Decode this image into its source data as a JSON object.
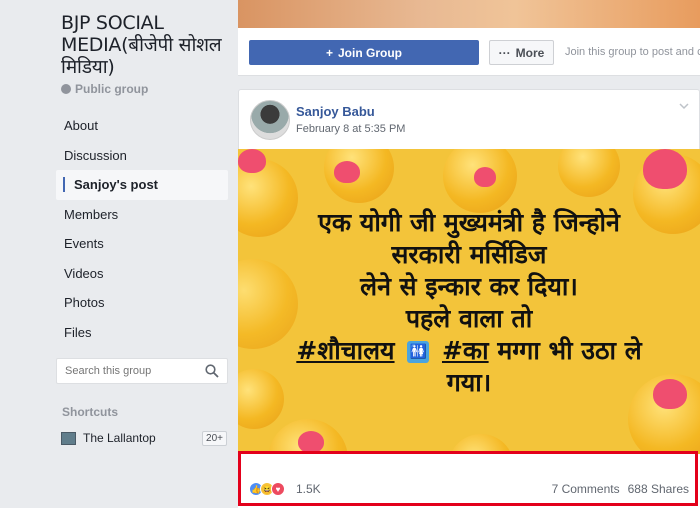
{
  "sidebar": {
    "group_title": "BJP SOCIAL MEDIA(बीजेपी सोशल मिडिया)",
    "privacy": "Public group",
    "nav": [
      {
        "label": "About"
      },
      {
        "label": "Discussion"
      },
      {
        "label": "Sanjoy's post",
        "active": true
      },
      {
        "label": "Members"
      },
      {
        "label": "Events"
      },
      {
        "label": "Videos"
      },
      {
        "label": "Photos"
      },
      {
        "label": "Files"
      }
    ],
    "search_placeholder": "Search this group",
    "shortcuts_title": "Shortcuts",
    "shortcut": {
      "label": "The Lallantop",
      "count": "20+"
    }
  },
  "header": {
    "join_label": "Join Group",
    "more_label": "More",
    "join_hint": "Join this group to post and c"
  },
  "post": {
    "author": "Sanjoy Babu",
    "timestamp": "February 8 at 5:35 PM",
    "image_text": {
      "line1": "एक योगी जी मुख्यमंत्री है जिन्होने",
      "line2": "सरकारी मर्सिडिज",
      "line3": "लेने से इन्कार कर दिया।",
      "line4": "पहले वाला तो",
      "hashtag1": "#शौचालय",
      "hashtag2": "#का",
      "line5_rest": "मग्गा भी उठा ले",
      "line6": "गया।"
    },
    "reaction_count": "1.5K",
    "comments": "7 Comments",
    "shares": "688 Shares"
  },
  "colors": {
    "brand": "#4267b2",
    "link": "#365899",
    "highlight": "#e3001b",
    "image_bg": "#f3c43a"
  },
  "icons": {
    "privacy": "globe-icon",
    "join": "plus-icon",
    "more": "ellipsis-icon",
    "search": "search-icon",
    "post_menu": "chevron-down-icon"
  }
}
